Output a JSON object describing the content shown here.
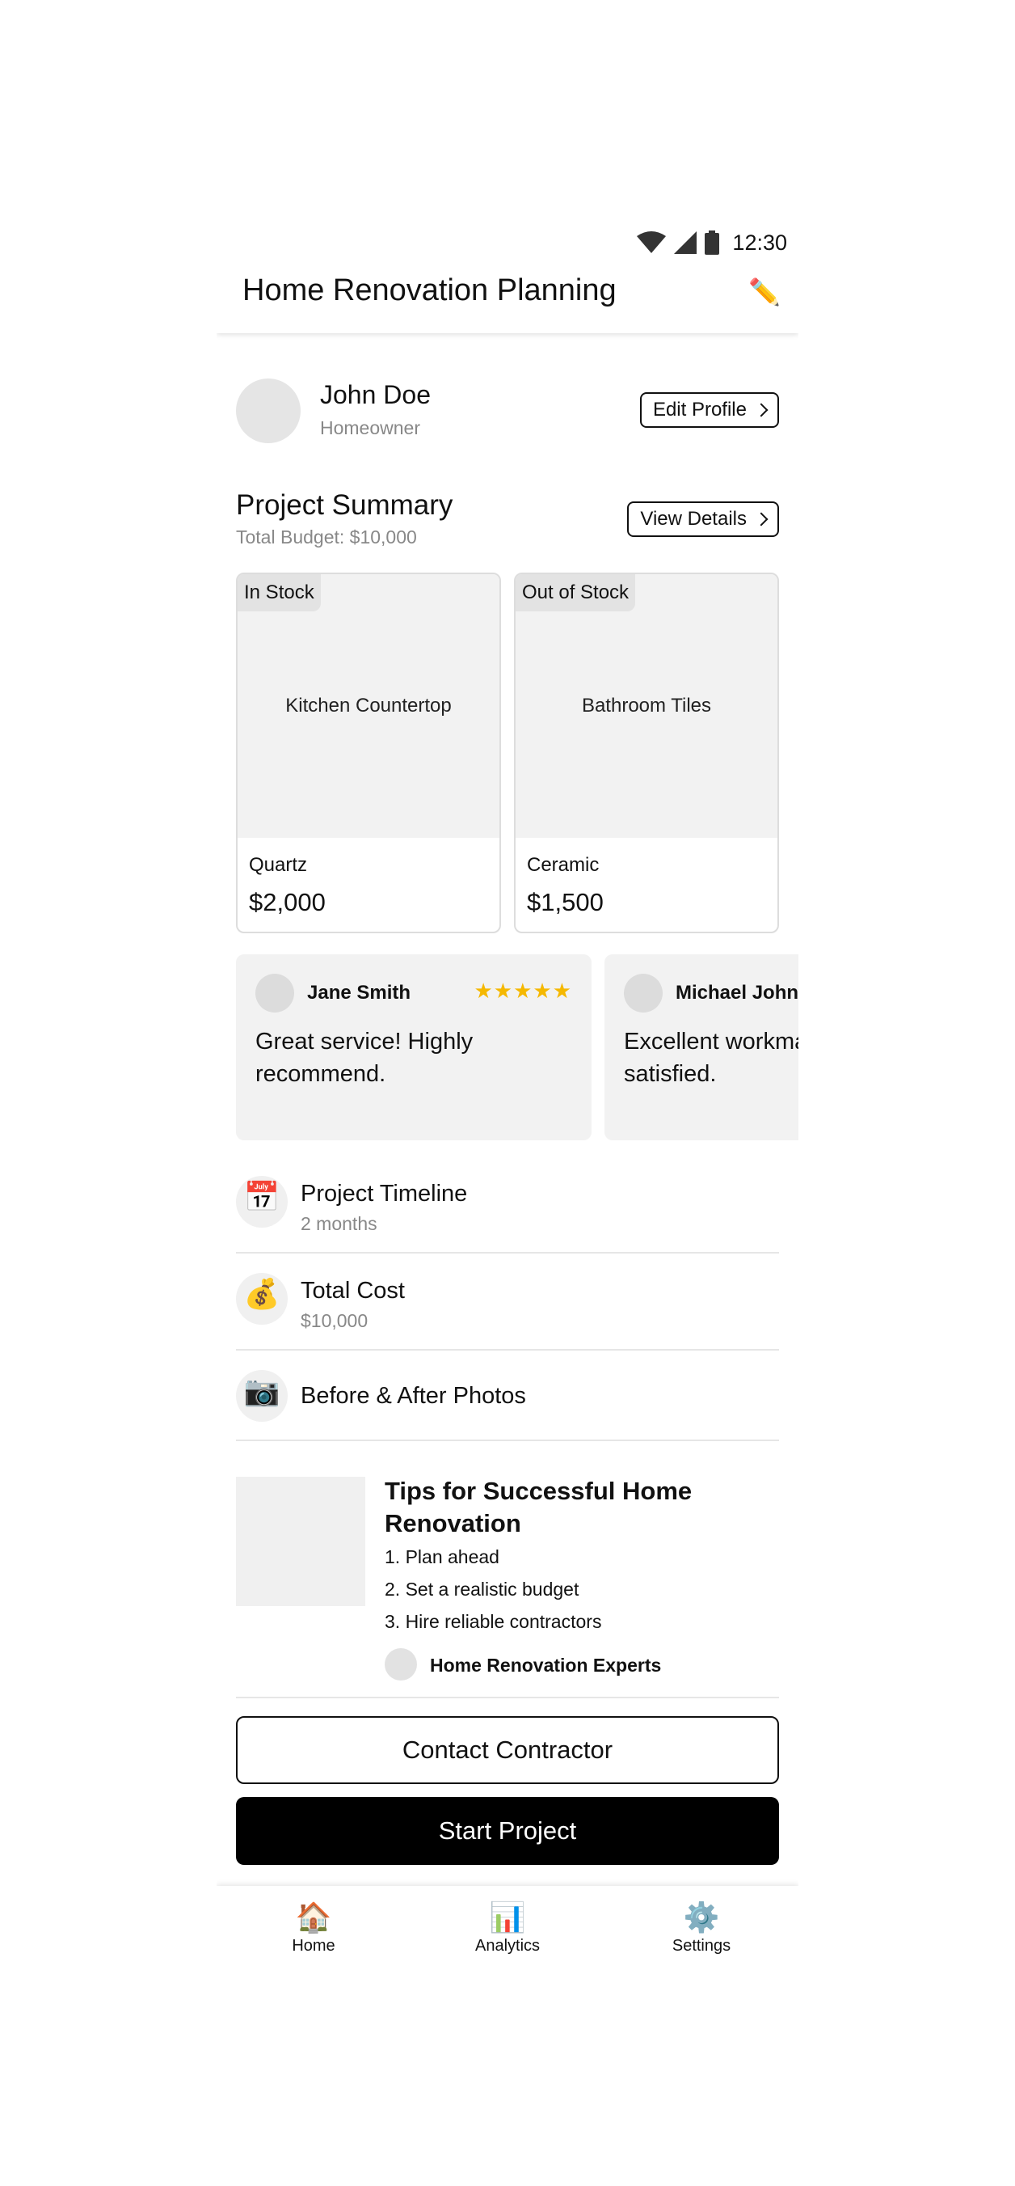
{
  "status": {
    "time": "12:30"
  },
  "header": {
    "title": "Home Renovation Planning",
    "edit_icon": "pencil-icon"
  },
  "profile": {
    "name": "John Doe",
    "role": "Homeowner",
    "edit_label": "Edit Profile"
  },
  "summary": {
    "title": "Project Summary",
    "budget": "Total Budget: $10,000",
    "details_label": "View Details"
  },
  "products": [
    {
      "badge": "In Stock",
      "name": "Kitchen Countertop",
      "material": "Quartz",
      "price": "$2,000"
    },
    {
      "badge": "Out of Stock",
      "name": "Bathroom Tiles",
      "material": "Ceramic",
      "price": "$1,500"
    }
  ],
  "reviews": [
    {
      "name": "Jane Smith",
      "stars": "★★★★★",
      "text": "Great service! Highly recommend."
    },
    {
      "name": "Michael Johnson",
      "stars": "★★★★★",
      "text": "Excellent workmanship, very satisfied."
    }
  ],
  "details": [
    {
      "icon": "📅",
      "title": "Project Timeline",
      "subtitle": "2 months"
    },
    {
      "icon": "💰",
      "title": "Total Cost",
      "subtitle": "$10,000"
    },
    {
      "icon": "📷",
      "title": "Before & After Photos"
    }
  ],
  "article": {
    "title": "Tips for Successful Home Renovation",
    "tips": [
      "1. Plan ahead",
      "2. Set a realistic budget",
      "3. Hire reliable contractors"
    ],
    "author": "Home Renovation Experts"
  },
  "actions": {
    "contact": "Contact Contractor",
    "start": "Start Project"
  },
  "nav": [
    {
      "icon": "🏠",
      "label": "Home"
    },
    {
      "icon": "📊",
      "label": "Analytics"
    },
    {
      "icon": "⚙️",
      "label": "Settings"
    }
  ]
}
